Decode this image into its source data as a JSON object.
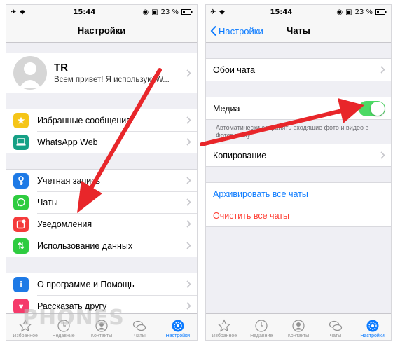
{
  "status_bar": {
    "time": "15:44",
    "battery": "23 %"
  },
  "left_screen": {
    "title": "Настройки",
    "profile": {
      "name": "TR",
      "status": "Всем привет! Я использую W..."
    },
    "group1": [
      {
        "label": "Избранные сообщения",
        "icon": "star-icon",
        "color": "#f5c518"
      },
      {
        "label": "WhatsApp Web",
        "icon": "laptop-icon",
        "color": "#16a085"
      }
    ],
    "group2": [
      {
        "label": "Учетная запись",
        "icon": "key-icon",
        "color": "#1e7ae6"
      },
      {
        "label": "Чаты",
        "icon": "whatsapp-icon",
        "color": "#2ecc40"
      },
      {
        "label": "Уведомления",
        "icon": "notification-icon",
        "color": "#f53b3b"
      },
      {
        "label": "Использование данных",
        "icon": "data-arrows-icon",
        "color": "#2ecc40"
      }
    ],
    "group3": [
      {
        "label": "О программе и Помощь",
        "icon": "info-icon",
        "color": "#1e7ae6"
      },
      {
        "label": "Рассказать другу",
        "icon": "heart-icon",
        "color": "#f53b6b"
      }
    ]
  },
  "right_screen": {
    "back_label": "Настройки",
    "title": "Чаты",
    "wallpaper_label": "Обои чата",
    "media_label": "Медиа",
    "media_enabled": true,
    "media_footnote": "Автоматически сохранять входящие фото и видео в Фотопленку.",
    "backup_label": "Копирование",
    "archive_all_label": "Архивировать все чаты",
    "clear_all_label": "Очистить все чаты"
  },
  "tab_bar": [
    {
      "label": "Избранное",
      "icon": "star-outline-icon"
    },
    {
      "label": "Недавние",
      "icon": "clock-icon"
    },
    {
      "label": "Контакты",
      "icon": "contact-icon"
    },
    {
      "label": "Чаты",
      "icon": "chat-bubbles-icon"
    },
    {
      "label": "Настройки",
      "icon": "settings-gear-icon",
      "active": true
    }
  ],
  "watermark": "PHONES",
  "colors": {
    "accent": "#0a7aff",
    "toggle_on": "#4cd964",
    "danger": "#ff3b30",
    "arrow": "#e8262a"
  }
}
